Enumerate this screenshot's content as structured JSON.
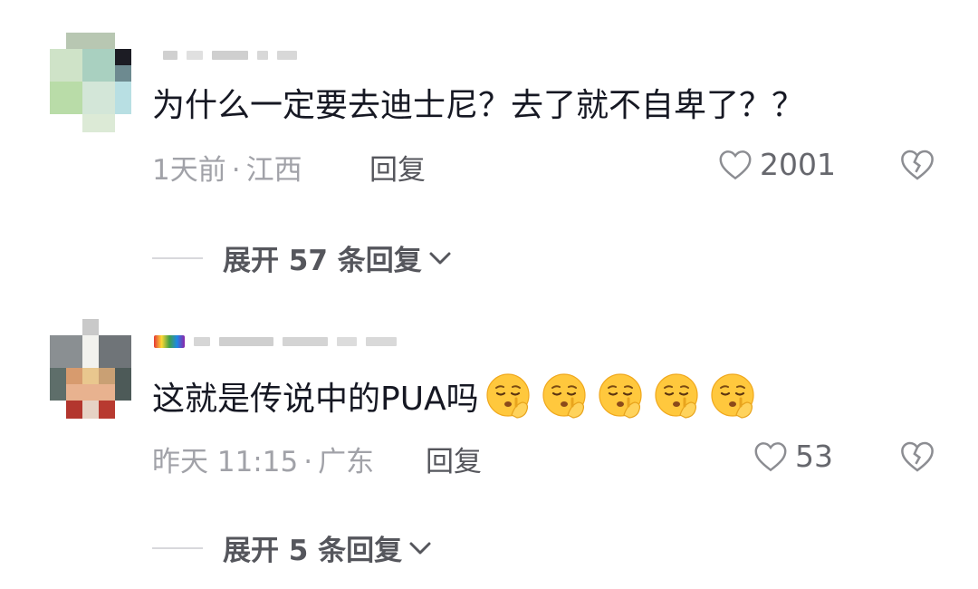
{
  "comments": [
    {
      "text": "为什么一定要去迪士尼？去了就不自卑了？？",
      "time": "1天前",
      "location": "江西",
      "reply_label": "回复",
      "likes": "2001",
      "expand": "展开 57 条回复",
      "avatar_icon": "pixelated-avatar",
      "emojis": []
    },
    {
      "text": "这就是传说中的PUA吗",
      "time": "昨天 11:15",
      "location": "广东",
      "reply_label": "回复",
      "likes": "53",
      "expand": "展开 5 条回复",
      "avatar_icon": "pixelated-avatar",
      "emojis": [
        "shushing-face-emoji",
        "shushing-face-emoji",
        "shushing-face-emoji",
        "shushing-face-emoji",
        "shushing-face-emoji"
      ]
    }
  ],
  "meta_separator": "·",
  "colors": {
    "text": "#161823",
    "meta": "#a1a2a8",
    "action": "#55565c",
    "emoji": "#ffc83d"
  },
  "icons": {
    "like": "heart-outline-icon",
    "dislike": "broken-heart-icon",
    "expand": "chevron-down-icon"
  }
}
